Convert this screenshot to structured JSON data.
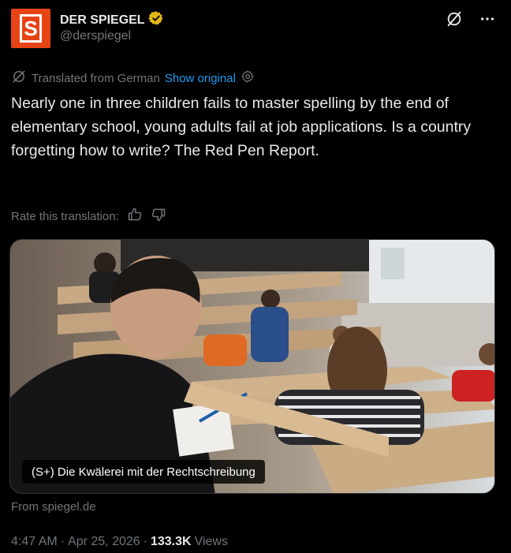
{
  "author": {
    "display_name": "DER SPIEGEL",
    "handle": "@derspiegel",
    "avatar_letter": "S",
    "verified_icon": "verified-badge-icon",
    "brand_color": "#e64415",
    "verified_color": "#e2b719"
  },
  "toolbar": {
    "grok_icon": "grok-icon",
    "more_icon": "more-icon"
  },
  "translation": {
    "label": "Translated from German",
    "show_original": "Show original",
    "rate_label": "Rate this translation:"
  },
  "tweet": {
    "text": "Nearly one in three children fails to master spelling by the end of elementary school, young adults fail at job applications. Is a country forgetting how to write? The Red Pen Report."
  },
  "card": {
    "caption": "(S+) Die Kwälerei mit der Rechtschreibung",
    "source": "From spiegel.de"
  },
  "meta": {
    "time": "4:47 AM",
    "sep1": "·",
    "date": "Apr 25, 2026",
    "sep2": "·",
    "views_count": "133.3K",
    "views_label": "Views"
  },
  "colors": {
    "background": "#000000",
    "text": "#e7e9ea",
    "secondary": "#71767b",
    "link": "#1d9bf0"
  }
}
